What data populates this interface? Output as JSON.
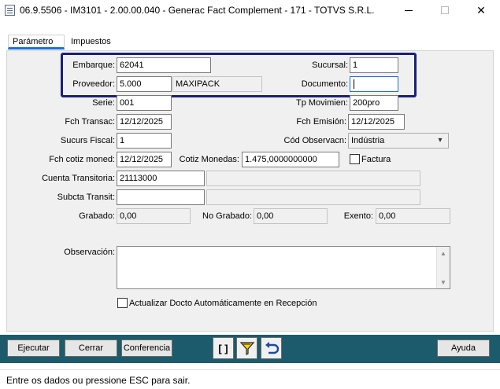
{
  "window": {
    "title": "06.9.5506 - IM3101 - 2.00.00.040 - Generac Fact Complement - 171 - TOTVS S.R.L.",
    "minimize_glyph": "minimize-icon",
    "maximize_glyph": "maximize-icon",
    "close_glyph": "✕"
  },
  "tabs": [
    {
      "label": "Parámetro",
      "active": true
    },
    {
      "label": "Impuestos",
      "active": false
    }
  ],
  "form": {
    "embarque": {
      "label": "Embarque:",
      "value": "62041"
    },
    "sucursal": {
      "label": "Sucursal:",
      "value": "1"
    },
    "proveedor": {
      "label": "Proveedor:",
      "value": "5.000",
      "name": "MAXIPACK"
    },
    "documento": {
      "label": "Documento:",
      "value": ""
    },
    "serie": {
      "label": "Serie:",
      "value": "001"
    },
    "tp_movimien": {
      "label": "Tp Movimien:",
      "value": "200pro"
    },
    "fch_transac": {
      "label": "Fch Transac:",
      "value": "12/12/2025"
    },
    "fch_emision": {
      "label": "Fch Emisión:",
      "value": "12/12/2025"
    },
    "sucurs_fiscal": {
      "label": "Sucurs Fiscal:",
      "value": "1"
    },
    "cod_observacn": {
      "label": "Cód Observacn:",
      "value": "Indústria",
      "arrow": "▾"
    },
    "fch_cotiz_moned": {
      "label": "Fch cotiz moned:",
      "value": "12/12/2025"
    },
    "cotiz_monedas": {
      "label": "Cotiz Monedas:",
      "value": "1.475,0000000000"
    },
    "factura": {
      "label": "Factura",
      "checked": false
    },
    "cuenta_transitoria": {
      "label": "Cuenta Transitoria:",
      "value": "21113000",
      "desc": ""
    },
    "subcta_transit": {
      "label": "Subcta Transit:",
      "value": "",
      "desc": ""
    },
    "grabado": {
      "label": "Grabado:",
      "value": "0,00"
    },
    "no_grabado": {
      "label": "No Grabado:",
      "value": "0,00"
    },
    "exento": {
      "label": "Exento:",
      "value": "0,00"
    },
    "observacion": {
      "label": "Observación:",
      "value": ""
    },
    "actualizar": {
      "label": "Actualizar Docto Automáticamente en Recepción",
      "checked": false
    }
  },
  "toolbar": {
    "ejecutar": "Ejecutar",
    "cerrar": "Cerrar",
    "conferencia": "Conferencia",
    "brackets": "[ ]",
    "ayuda": "Ayuda"
  },
  "status": {
    "text": "Entre os dados ou pressione ESC para sair."
  },
  "colors": {
    "highlight_border": "#1b1f7a",
    "toolbar_bg": "#1c5b6c",
    "tab_underline": "#1d6fd8"
  }
}
